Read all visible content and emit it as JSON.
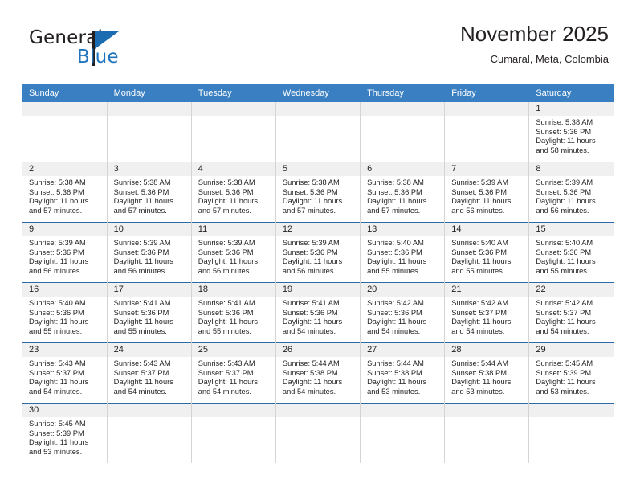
{
  "brand": {
    "name_part1": "General",
    "name_part2": "Blue",
    "logo_icon": "blue-triangle-mark",
    "accent_color": "#1f74bd"
  },
  "header": {
    "month_title": "November 2025",
    "location": "Cumaral, Meta, Colombia"
  },
  "calendar": {
    "header_bg": "#3a7fc1",
    "weekday_headers": [
      "Sunday",
      "Monday",
      "Tuesday",
      "Wednesday",
      "Thursday",
      "Friday",
      "Saturday"
    ],
    "labels": {
      "sunrise": "Sunrise:",
      "sunset": "Sunset:",
      "daylight": "Daylight:"
    },
    "weeks": [
      [
        {
          "day": ""
        },
        {
          "day": ""
        },
        {
          "day": ""
        },
        {
          "day": ""
        },
        {
          "day": ""
        },
        {
          "day": ""
        },
        {
          "day": "1",
          "sunrise": "Sunrise: 5:38 AM",
          "sunset": "Sunset: 5:36 PM",
          "daylight_line1": "Daylight: 11 hours",
          "daylight_line2": "and 58 minutes."
        }
      ],
      [
        {
          "day": "2",
          "sunrise": "Sunrise: 5:38 AM",
          "sunset": "Sunset: 5:36 PM",
          "daylight_line1": "Daylight: 11 hours",
          "daylight_line2": "and 57 minutes."
        },
        {
          "day": "3",
          "sunrise": "Sunrise: 5:38 AM",
          "sunset": "Sunset: 5:36 PM",
          "daylight_line1": "Daylight: 11 hours",
          "daylight_line2": "and 57 minutes."
        },
        {
          "day": "4",
          "sunrise": "Sunrise: 5:38 AM",
          "sunset": "Sunset: 5:36 PM",
          "daylight_line1": "Daylight: 11 hours",
          "daylight_line2": "and 57 minutes."
        },
        {
          "day": "5",
          "sunrise": "Sunrise: 5:38 AM",
          "sunset": "Sunset: 5:36 PM",
          "daylight_line1": "Daylight: 11 hours",
          "daylight_line2": "and 57 minutes."
        },
        {
          "day": "6",
          "sunrise": "Sunrise: 5:38 AM",
          "sunset": "Sunset: 5:36 PM",
          "daylight_line1": "Daylight: 11 hours",
          "daylight_line2": "and 57 minutes."
        },
        {
          "day": "7",
          "sunrise": "Sunrise: 5:39 AM",
          "sunset": "Sunset: 5:36 PM",
          "daylight_line1": "Daylight: 11 hours",
          "daylight_line2": "and 56 minutes."
        },
        {
          "day": "8",
          "sunrise": "Sunrise: 5:39 AM",
          "sunset": "Sunset: 5:36 PM",
          "daylight_line1": "Daylight: 11 hours",
          "daylight_line2": "and 56 minutes."
        }
      ],
      [
        {
          "day": "9",
          "sunrise": "Sunrise: 5:39 AM",
          "sunset": "Sunset: 5:36 PM",
          "daylight_line1": "Daylight: 11 hours",
          "daylight_line2": "and 56 minutes."
        },
        {
          "day": "10",
          "sunrise": "Sunrise: 5:39 AM",
          "sunset": "Sunset: 5:36 PM",
          "daylight_line1": "Daylight: 11 hours",
          "daylight_line2": "and 56 minutes."
        },
        {
          "day": "11",
          "sunrise": "Sunrise: 5:39 AM",
          "sunset": "Sunset: 5:36 PM",
          "daylight_line1": "Daylight: 11 hours",
          "daylight_line2": "and 56 minutes."
        },
        {
          "day": "12",
          "sunrise": "Sunrise: 5:39 AM",
          "sunset": "Sunset: 5:36 PM",
          "daylight_line1": "Daylight: 11 hours",
          "daylight_line2": "and 56 minutes."
        },
        {
          "day": "13",
          "sunrise": "Sunrise: 5:40 AM",
          "sunset": "Sunset: 5:36 PM",
          "daylight_line1": "Daylight: 11 hours",
          "daylight_line2": "and 55 minutes."
        },
        {
          "day": "14",
          "sunrise": "Sunrise: 5:40 AM",
          "sunset": "Sunset: 5:36 PM",
          "daylight_line1": "Daylight: 11 hours",
          "daylight_line2": "and 55 minutes."
        },
        {
          "day": "15",
          "sunrise": "Sunrise: 5:40 AM",
          "sunset": "Sunset: 5:36 PM",
          "daylight_line1": "Daylight: 11 hours",
          "daylight_line2": "and 55 minutes."
        }
      ],
      [
        {
          "day": "16",
          "sunrise": "Sunrise: 5:40 AM",
          "sunset": "Sunset: 5:36 PM",
          "daylight_line1": "Daylight: 11 hours",
          "daylight_line2": "and 55 minutes."
        },
        {
          "day": "17",
          "sunrise": "Sunrise: 5:41 AM",
          "sunset": "Sunset: 5:36 PM",
          "daylight_line1": "Daylight: 11 hours",
          "daylight_line2": "and 55 minutes."
        },
        {
          "day": "18",
          "sunrise": "Sunrise: 5:41 AM",
          "sunset": "Sunset: 5:36 PM",
          "daylight_line1": "Daylight: 11 hours",
          "daylight_line2": "and 55 minutes."
        },
        {
          "day": "19",
          "sunrise": "Sunrise: 5:41 AM",
          "sunset": "Sunset: 5:36 PM",
          "daylight_line1": "Daylight: 11 hours",
          "daylight_line2": "and 54 minutes."
        },
        {
          "day": "20",
          "sunrise": "Sunrise: 5:42 AM",
          "sunset": "Sunset: 5:36 PM",
          "daylight_line1": "Daylight: 11 hours",
          "daylight_line2": "and 54 minutes."
        },
        {
          "day": "21",
          "sunrise": "Sunrise: 5:42 AM",
          "sunset": "Sunset: 5:37 PM",
          "daylight_line1": "Daylight: 11 hours",
          "daylight_line2": "and 54 minutes."
        },
        {
          "day": "22",
          "sunrise": "Sunrise: 5:42 AM",
          "sunset": "Sunset: 5:37 PM",
          "daylight_line1": "Daylight: 11 hours",
          "daylight_line2": "and 54 minutes."
        }
      ],
      [
        {
          "day": "23",
          "sunrise": "Sunrise: 5:43 AM",
          "sunset": "Sunset: 5:37 PM",
          "daylight_line1": "Daylight: 11 hours",
          "daylight_line2": "and 54 minutes."
        },
        {
          "day": "24",
          "sunrise": "Sunrise: 5:43 AM",
          "sunset": "Sunset: 5:37 PM",
          "daylight_line1": "Daylight: 11 hours",
          "daylight_line2": "and 54 minutes."
        },
        {
          "day": "25",
          "sunrise": "Sunrise: 5:43 AM",
          "sunset": "Sunset: 5:37 PM",
          "daylight_line1": "Daylight: 11 hours",
          "daylight_line2": "and 54 minutes."
        },
        {
          "day": "26",
          "sunrise": "Sunrise: 5:44 AM",
          "sunset": "Sunset: 5:38 PM",
          "daylight_line1": "Daylight: 11 hours",
          "daylight_line2": "and 54 minutes."
        },
        {
          "day": "27",
          "sunrise": "Sunrise: 5:44 AM",
          "sunset": "Sunset: 5:38 PM",
          "daylight_line1": "Daylight: 11 hours",
          "daylight_line2": "and 53 minutes."
        },
        {
          "day": "28",
          "sunrise": "Sunrise: 5:44 AM",
          "sunset": "Sunset: 5:38 PM",
          "daylight_line1": "Daylight: 11 hours",
          "daylight_line2": "and 53 minutes."
        },
        {
          "day": "29",
          "sunrise": "Sunrise: 5:45 AM",
          "sunset": "Sunset: 5:39 PM",
          "daylight_line1": "Daylight: 11 hours",
          "daylight_line2": "and 53 minutes."
        }
      ],
      [
        {
          "day": "30",
          "sunrise": "Sunrise: 5:45 AM",
          "sunset": "Sunset: 5:39 PM",
          "daylight_line1": "Daylight: 11 hours",
          "daylight_line2": "and 53 minutes."
        },
        {
          "day": ""
        },
        {
          "day": ""
        },
        {
          "day": ""
        },
        {
          "day": ""
        },
        {
          "day": ""
        },
        {
          "day": ""
        }
      ]
    ]
  }
}
